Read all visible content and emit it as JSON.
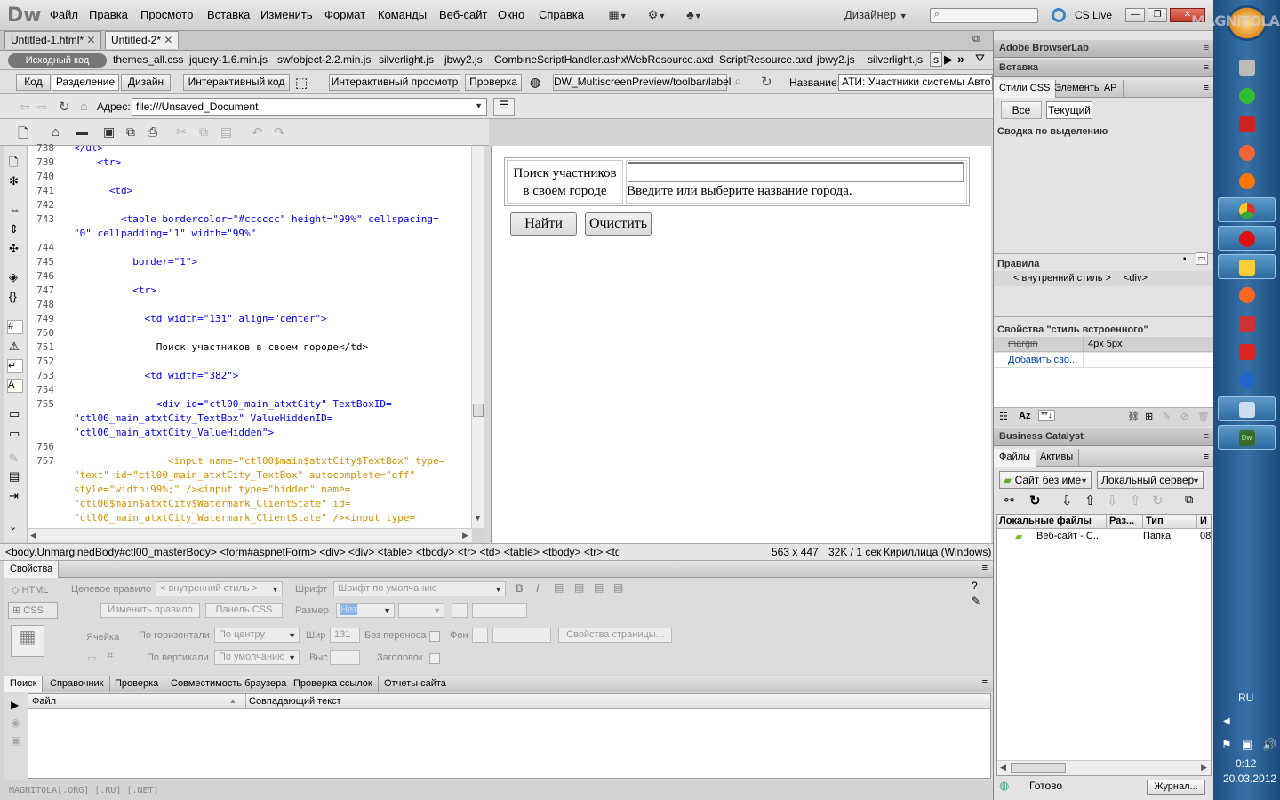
{
  "menubar": {
    "logo": "Dw",
    "items": [
      "Файл",
      "Правка",
      "Просмотр",
      "Вставка",
      "Изменить",
      "Формат",
      "Команды",
      "Веб-сайт",
      "Окно",
      "Справка"
    ],
    "workspace": "Дизайнер",
    "cs_live": "CS Live"
  },
  "doc_tabs": [
    "Untitled-1.html*",
    "Untitled-2*"
  ],
  "related_files": {
    "source_label": "Исходный код",
    "files": [
      "themes_all.css",
      "jquery-1.6.min.js",
      "swfobject-2.2.min.js",
      "silverlight.js",
      "jbwy2.js",
      "CombineScriptHandler.ashx",
      "WebResource.axd",
      "ScriptResource.axd",
      "jbwy2.js",
      "silverlight.js",
      "s"
    ]
  },
  "view_bar": {
    "code": "Код",
    "split": "Разделение",
    "design": "Дизайн",
    "live_code": "Интерактивный код",
    "live_view": "Интерактивный просмотр",
    "check": "Проверка",
    "multiscreen": "DW_MultiscreenPreview/toolbar/label",
    "title_label": "Название:",
    "title_value": "АТИ: Участники системы АвтоТра"
  },
  "address": {
    "label": "Адрес:",
    "value": "file:///Unsaved_Document"
  },
  "code": {
    "lines": [
      {
        "n": "738",
        "t": "</ul>",
        "cls": "tag",
        "cont": []
      },
      {
        "n": "739",
        "t": "    <tr>",
        "cls": "tag",
        "cont": []
      },
      {
        "n": "740",
        "t": "",
        "cls": "tag",
        "cont": []
      },
      {
        "n": "741",
        "t": "      <td>",
        "cls": "tag",
        "cont": []
      },
      {
        "n": "742",
        "t": "",
        "cls": "tag",
        "cont": []
      },
      {
        "n": "743",
        "t": "        <table bordercolor=\"#cccccc\" height=\"99%\" cellspacing=",
        "cls": "tag",
        "cont": [
          "\"0\" cellpadding=\"1\" width=\"99%\""
        ]
      },
      {
        "n": "744",
        "t": "",
        "cls": "tag",
        "cont": []
      },
      {
        "n": "745",
        "t": "          border=\"1\">",
        "cls": "tag",
        "cont": []
      },
      {
        "n": "746",
        "t": "",
        "cls": "tag",
        "cont": []
      },
      {
        "n": "747",
        "t": "          <tr>",
        "cls": "tag",
        "cont": []
      },
      {
        "n": "748",
        "t": "",
        "cls": "tag",
        "cont": []
      },
      {
        "n": "749",
        "t": "            <td width=\"131\" align=\"center\">",
        "cls": "tag",
        "cont": []
      },
      {
        "n": "750",
        "t": "",
        "cls": "tag",
        "cont": []
      },
      {
        "n": "751",
        "t": "              Поиск участников в своем городе</td>",
        "cls": "text",
        "cont": []
      },
      {
        "n": "752",
        "t": "",
        "cls": "tag",
        "cont": []
      },
      {
        "n": "753",
        "t": "            <td width=\"382\">",
        "cls": "tag",
        "cont": []
      },
      {
        "n": "754",
        "t": "",
        "cls": "tag",
        "cont": []
      },
      {
        "n": "755",
        "t": "              <div id=\"ctl00_main_atxtCity\" TextBoxID=",
        "cls": "tag",
        "cont": [
          "\"ctl00_main_atxtCity_TextBox\" ValueHiddenID=",
          "\"ctl00_main_atxtCity_ValueHidden\">"
        ]
      },
      {
        "n": "756",
        "t": "",
        "cls": "tag",
        "cont": []
      },
      {
        "n": "757",
        "t": "                <input name=\"ctl00$main$atxtCity$TextBox\" type=",
        "cls": "orange",
        "cont": [
          "\"text\" id=\"ctl00_main_atxtCity_TextBox\" autocomplete=\"off\"",
          "style=\"width:99%;\" /><input type=\"hidden\" name=",
          "\"ctl00$main$atxtCity$Watermark_ClientState\" id=",
          "\"ctl00_main_atxtCity_Watermark_ClientState\" /><input type="
        ]
      }
    ]
  },
  "design": {
    "label": "Поиск участников в своем городе",
    "label_line1": "Поиск участников",
    "label_line2": "в своем городе",
    "hint": "Введите или выберите название города.",
    "find_button": "Найти",
    "clear_button": "Очистить"
  },
  "status": {
    "tag_path": "<body.UnmarginedBody#ctl00_masterBody> <form#aspnetForm> <div> <div> <table> <tbody> <tr> <td> <table> <tbody> <tr> <td>",
    "size": "563 x 447",
    "weight": "32K / 1 сек",
    "encoding": "Кириллица (Windows)"
  },
  "properties": {
    "title": "Свойства",
    "html": "HTML",
    "css": "CSS",
    "target_rule_label": "Целевое правило",
    "target_rule": "< внутренний стиль >",
    "edit_rule": "Изменить правило",
    "css_panel": "Панель CSS",
    "font_label": "Шрифт",
    "font_value": "Шрифт по умолчанию",
    "size_label": "Размер",
    "size_value": "Нет",
    "cell_label": "Ячейка",
    "horiz_label": "По горизонтали",
    "horiz_value": "По центру",
    "vert_label": "По вертикали",
    "vert_value": "По умолчанию",
    "width_label": "Шир",
    "width_value": "131",
    "height_label": "Выс",
    "nowrap_label": "Без переноса",
    "bg_label": "Фон",
    "header_label": "Заголовок",
    "page_props": "Свойства страницы..."
  },
  "results": {
    "tabs": [
      "Поиск",
      "Справочник",
      "Проверка",
      "Совместимость браузера",
      "Проверка ссылок",
      "Отчеты сайта"
    ],
    "col_file": "Файл",
    "col_match": "Совпадающий текст",
    "watermark": "MAGNITOLA[.ORG] [.RU] [.NET]"
  },
  "right_panel": {
    "browserlab": "Adobe BrowserLab",
    "insert": "Вставка",
    "css_styles": "Стили CSS",
    "ap_elements": "Элементы AP",
    "all": "Все",
    "current": "Текущий",
    "summary": "Сводка по выделению",
    "rules": "Правила",
    "rule_1": "< внутренний стиль >",
    "rule_2": "<div>",
    "props_title": "Свойства \"стиль встроенного\"",
    "prop_name": "margin",
    "prop_value": "4px 5px",
    "add_prop": "Добавить сво...",
    "business_catalyst": "Business Catalyst",
    "files_tab": "Файлы",
    "assets_tab": "Активы",
    "site_select": "Сайт без име",
    "server_select": "Локальный сервер",
    "col_local": "Локальные файлы",
    "col_size": "Раз...",
    "col_type": "Тип",
    "col_extra": "И",
    "file_name": "Веб-сайт - С...",
    "file_type": "Папка",
    "file_extra": "08",
    "ready": "Готово",
    "log": "Журнал..."
  },
  "taskbar": {
    "lang": "RU",
    "time": "0:12",
    "date": "20.03.2012",
    "brand": "MAGNITOLA"
  },
  "colors": {
    "taskbar": "#2b62a0",
    "code_tag": "#0000ff",
    "code_attr": "#00aa66",
    "code_orange": "#d39100"
  }
}
